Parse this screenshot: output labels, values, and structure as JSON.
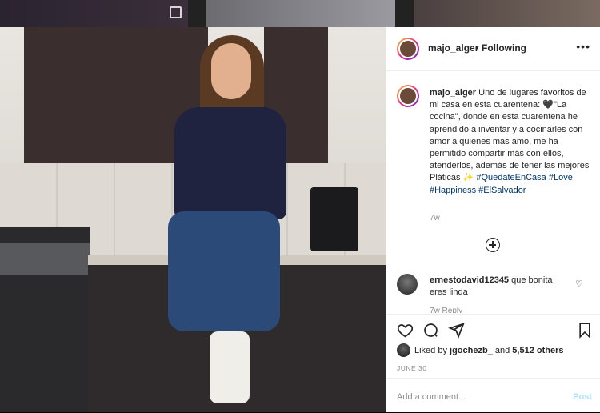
{
  "post": {
    "username": "majo_alger",
    "separator": "•",
    "follow_status": "Following",
    "more_icon": "more-horizontal-icon",
    "caption_user": "majo_alger",
    "caption_text": " Uno de lugares favoritos de mi casa en esta cuarentena: 🖤\"La cocina\", donde en esta cuarentena he aprendido a inventar y a cocinarles con amor a quienes más amo, me ha permitido compartir más con ellos, atenderlos, además de tener las mejores Pláticas ✨ ",
    "hashtags": [
      "#QuedateEnCasa",
      "#Love",
      "#Happiness",
      "#ElSalvador"
    ],
    "caption_time": "7w",
    "comment_user": "ernestodavid12345",
    "comment_text": " que bonita eres linda",
    "comment_meta": "7w   Reply",
    "likes_prefix": "Liked by ",
    "likes_user": "jgochezb_",
    "likes_middle": " and ",
    "likes_count": "5,512 others",
    "date": "JUNE 30",
    "add_comment_placeholder": "Add a comment...",
    "post_button": "Post"
  }
}
